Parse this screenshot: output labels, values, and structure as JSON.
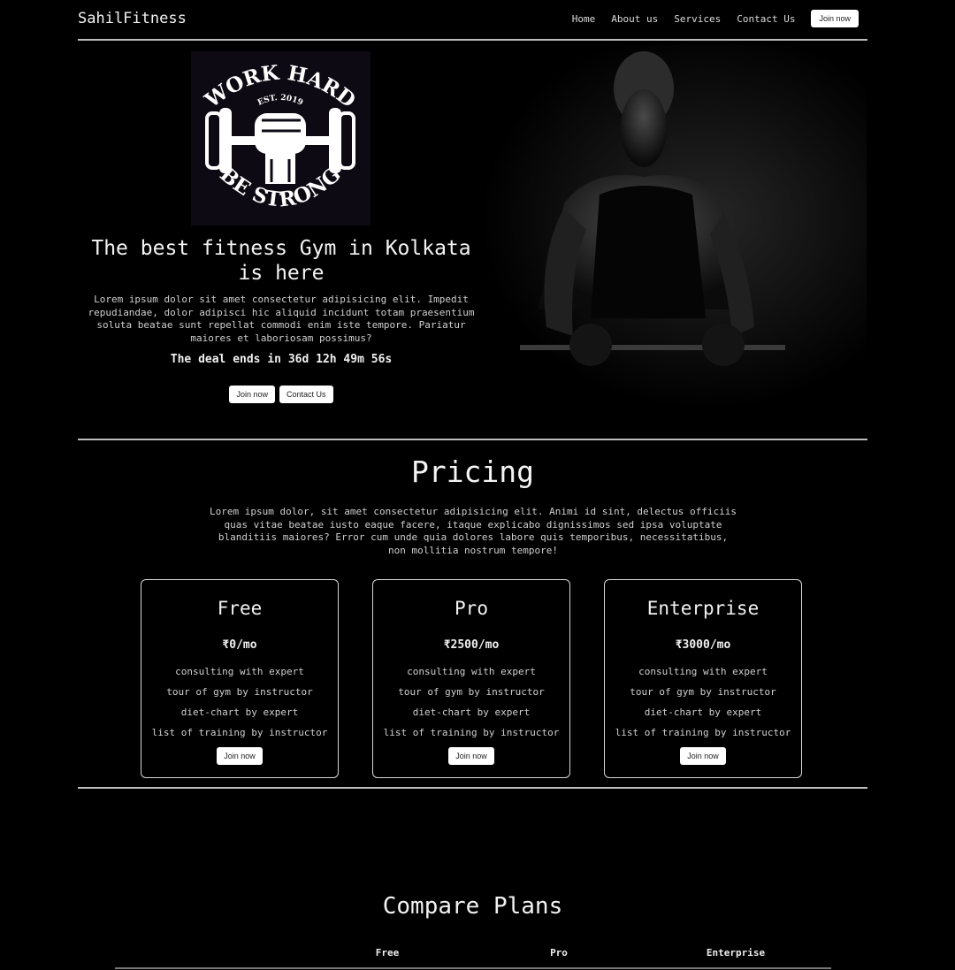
{
  "nav": {
    "brand": "SahilFitness",
    "links": [
      "Home",
      "About us",
      "Services",
      "Contact Us"
    ],
    "join_label": "Join now"
  },
  "hero": {
    "logo": {
      "top_text": "WORK HARD",
      "est_text": "EST. 2019",
      "bottom_text": "BE STRONG"
    },
    "title": "The best fitness Gym in Kolkata is here",
    "description": "Lorem ipsum dolor sit amet consectetur adipisicing elit. Impedit repudiandae, dolor adipisci hic aliquid incidunt totam praesentium soluta beatae sunt repellat commodi enim iste tempore. Pariatur maiores et laboriosam possimus?",
    "deal_text": "The deal ends in 36d 12h 49m 56s",
    "join_label": "Join now",
    "contact_label": "Contact Us"
  },
  "pricing": {
    "title": "Pricing",
    "description": "Lorem ipsum dolor, sit amet consectetur adipisicing elit. Animi id sint, delectus officiis quas vitae beatae iusto eaque facere, itaque explicabo dignissimos sed ipsa voluptate blanditiis maiores? Error cum unde quia dolores labore quis temporibus, necessitatibus, non mollitia nostrum tempore!",
    "plans": [
      {
        "name": "Free",
        "price": "₹0/mo",
        "features": [
          "consulting with expert",
          "tour of gym by instructor",
          "diet-chart by expert",
          "list of training by instructor"
        ],
        "button": "Join now"
      },
      {
        "name": "Pro",
        "price": "₹2500/mo",
        "features": [
          "consulting with expert",
          "tour of gym by instructor",
          "diet-chart by expert",
          "list of training by instructor"
        ],
        "button": "Join now"
      },
      {
        "name": "Enterprise",
        "price": "₹3000/mo",
        "features": [
          "consulting with expert",
          "tour of gym by instructor",
          "diet-chart by expert",
          "list of training by instructor"
        ],
        "button": "Join now"
      }
    ]
  },
  "compare": {
    "title": "Compare Plans",
    "columns": [
      "Free",
      "Pro",
      "Enterprise"
    ]
  },
  "colors": {
    "background": "#000000",
    "text": "#e8e8e8",
    "button_bg": "#ffffff",
    "divider": "#bdbdbd"
  }
}
